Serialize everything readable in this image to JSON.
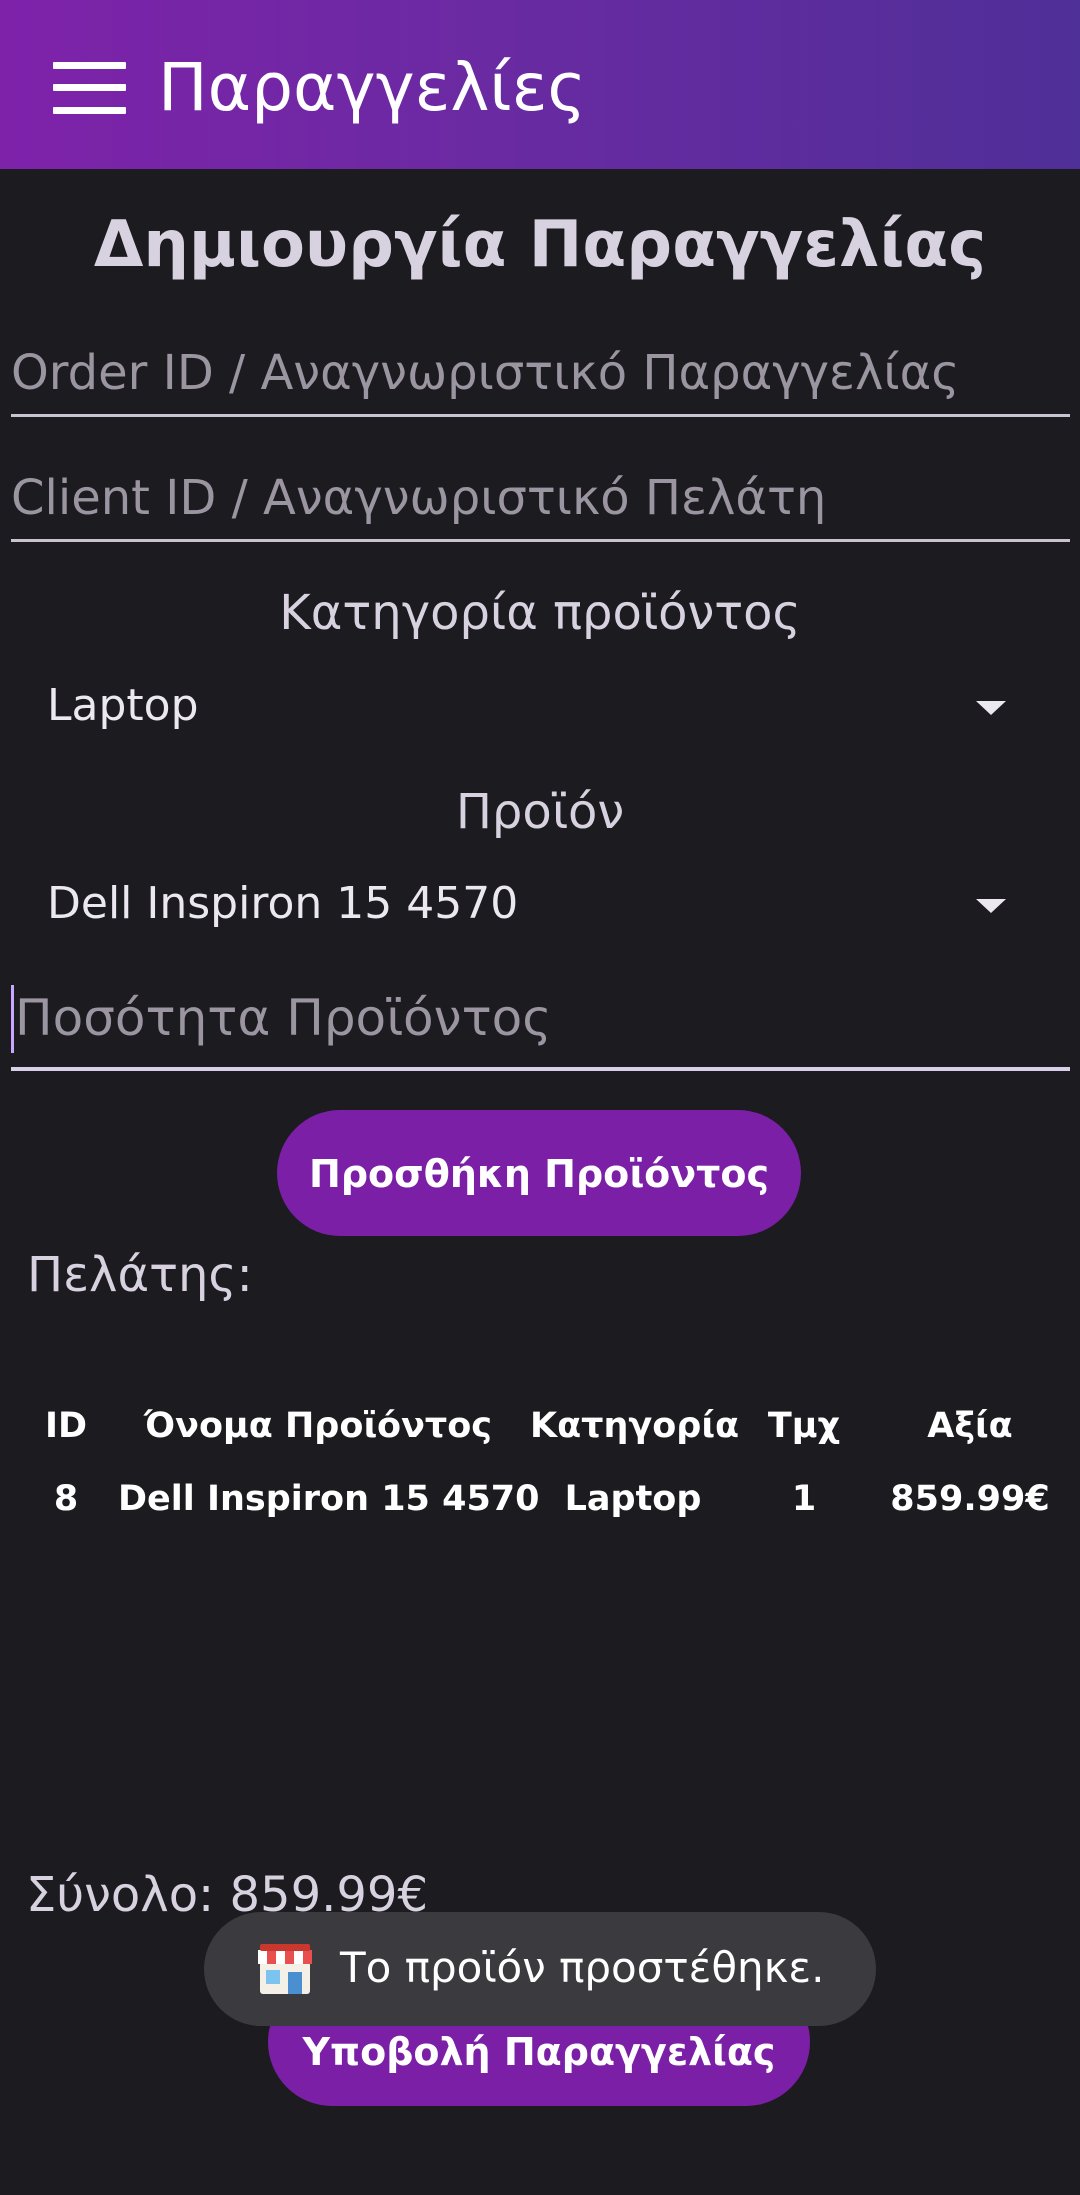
{
  "appbar": {
    "title": "Παραγγελίες",
    "menu_icon": "hamburger-menu-icon"
  },
  "form": {
    "heading": "Δημιουργία Παραγγελίας",
    "order_id_placeholder": "Order ID / Αναγνωριστικό Παραγγελίας",
    "client_id_placeholder": "Client ID / Αναγνωριστικό Πελάτη",
    "category_label": "Κατηγορία προϊόντος",
    "category_value": "Laptop",
    "product_label": "Προϊόν",
    "product_value": "Dell Inspiron 15 4570",
    "quantity_placeholder": "Ποσότητα Προϊόντος",
    "add_button": "Προσθήκη Προϊόντος"
  },
  "client": {
    "label": "Πελάτης:"
  },
  "table": {
    "headers": [
      "ID",
      "Όνομα Προϊόντος",
      "Κατηγορία",
      "Τμχ",
      "Αξία"
    ],
    "rows": [
      [
        "8",
        "Dell Inspiron 15 4570",
        "Laptop",
        "1",
        "859.99€"
      ]
    ]
  },
  "summary": {
    "total": "Σύνολο: 859.99€",
    "submit_button": "Υποβολή Παραγγελίας"
  },
  "toast": {
    "icon": "store-icon",
    "message": "Το προϊόν προστέθηκε."
  },
  "colors": {
    "appbar_start": "#7e22aa",
    "appbar_end": "#4f2f98",
    "background": "#1c1b20",
    "button": "#7a1fa6",
    "toast": "#3b3a3e"
  }
}
